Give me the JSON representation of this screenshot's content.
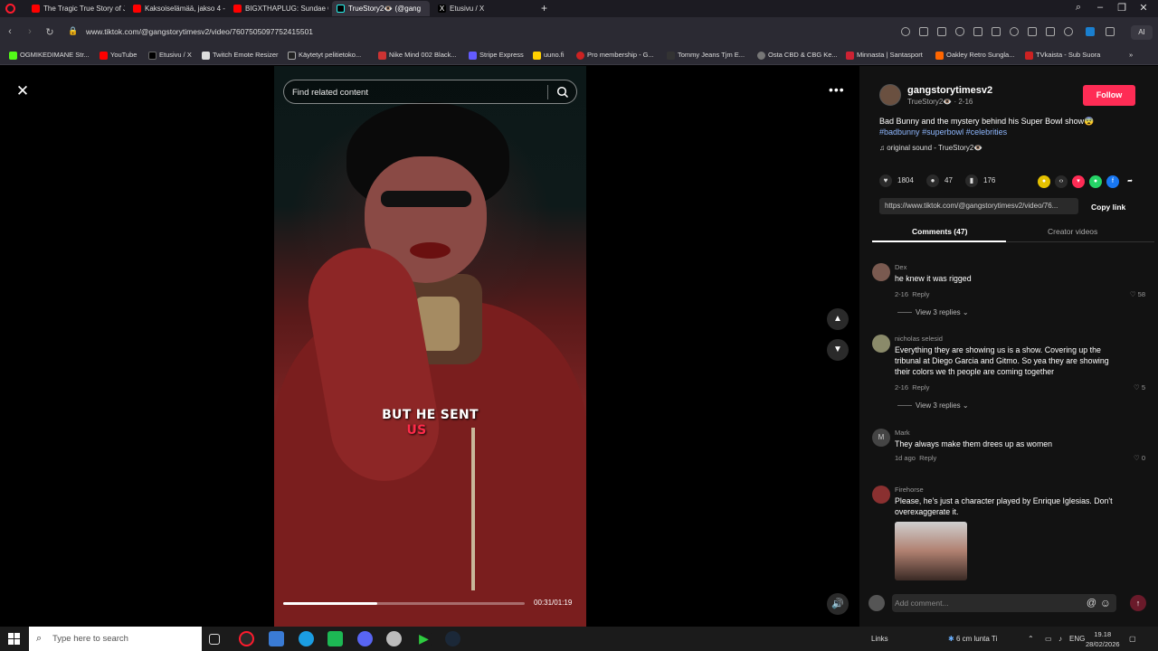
{
  "browser": {
    "tabs": [
      {
        "label": "The Tragic True Story of Ju",
        "color": "#ff0000"
      },
      {
        "label": "Kaksoiselämää, jakso 4 - Li",
        "color": "#ff0000"
      },
      {
        "label": "BIGXTHAPLUG: Sundae C",
        "color": "#ff0000"
      },
      {
        "label": "TrueStory2👁️ (@gang",
        "color": "#000000",
        "active": true
      },
      {
        "label": "Etusivu / X",
        "color": "#000000"
      }
    ],
    "new_tab": "+",
    "url": "www.tiktok.com/@gangstorytimesv2/video/7607505097752415501",
    "ai_label": "AI",
    "bookmarks": [
      {
        "label": "OGMIKEDIMANE Str...",
        "color": "#53fc18"
      },
      {
        "label": "YouTube",
        "color": "#ff0000"
      },
      {
        "label": "Etusivu / X",
        "color": "#000000"
      },
      {
        "label": "Twitch Emote Resizer",
        "color": "#dddddd"
      },
      {
        "label": "Käytetyt pelitietoko...",
        "color": "#222222"
      },
      {
        "label": "Nike Mind 002 Black...",
        "color": "#cc3333"
      },
      {
        "label": "Stripe Express",
        "color": "#635bff"
      },
      {
        "label": "uuno.fi",
        "color": "#ffd000"
      },
      {
        "label": "Pro membership - G...",
        "color": "#cc2222"
      },
      {
        "label": "Tommy Jeans Tjm E...",
        "color": "#333333"
      },
      {
        "label": "Osta CBD & CBG Ke...",
        "color": "#777777"
      },
      {
        "label": "Minnasta | Santasport",
        "color": "#cc2233"
      },
      {
        "label": "Oakley Retro Sungla...",
        "color": "#ff6600"
      },
      {
        "label": "TVkaista - Sub Suora",
        "color": "#cc2222"
      }
    ]
  },
  "video": {
    "search_placeholder": "Find related content",
    "caption_line1": "BUT HE SENT",
    "caption_line2": "US",
    "progress": 0.39,
    "time": "00:31/01:19"
  },
  "panel": {
    "author_name": "gangstorytimesv2",
    "author_meta": "TrueStory2👁️ · 2-16",
    "follow": "Follow",
    "desc_text": "Bad Bunny and the mystery behind his Super Bowl show😨",
    "tags": [
      "#badbunny",
      "#superbowl",
      "#celebrities"
    ],
    "sound": "♫  original sound - TrueStory2👁️",
    "likes": "1804",
    "comments_count": "47",
    "saves": "176",
    "link": "https://www.tiktok.com/@gangstorytimesv2/video/76...",
    "copy_link": "Copy link",
    "tab_comments": "Comments (47)",
    "tab_creator": "Creator videos",
    "comments": [
      {
        "user": "Dex",
        "text": "he knew it was rigged",
        "date": "2-16",
        "reply": "Reply",
        "likes": "58",
        "replies": "View 3 replies"
      },
      {
        "user": "nicholas selesid",
        "text": "Everything they are showing us is a show. Covering up the tribunal at Diego Garcia and Gitmo. So yea they are showing their colors we th people are coming together",
        "date": "2-16",
        "reply": "Reply",
        "likes": "5",
        "replies": "View 3 replies"
      },
      {
        "user": "Mark",
        "avatar_letter": "M",
        "text": "They always make them drees up as women",
        "date": "1d ago",
        "reply": "Reply",
        "likes": "0"
      },
      {
        "user": "Firehorse",
        "text": "Please, he's just a character played by Enrique Iglesias. Don't overexaggerate it."
      }
    ],
    "add_comment_placeholder": "Add comment...",
    "at_icon": "@",
    "emoji_icon": "☺"
  },
  "taskbar": {
    "search_placeholder": "Type here to search",
    "links": "Links",
    "weather": "6 cm lunta Ti",
    "lang": "ENG",
    "time": "19.18",
    "date": "28/02/2026"
  }
}
